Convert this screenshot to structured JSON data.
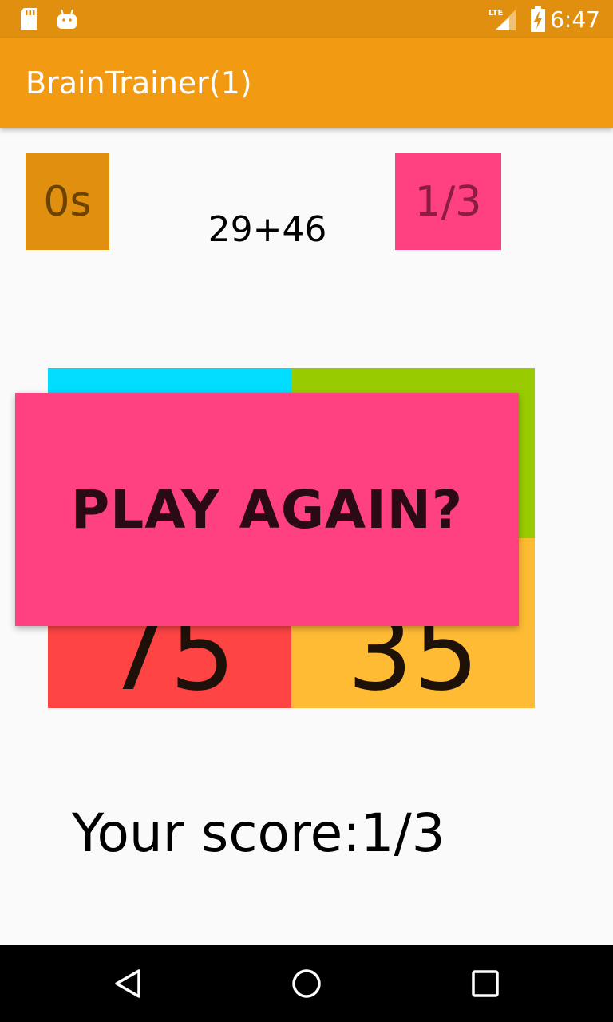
{
  "status_bar": {
    "time": "6:47",
    "network": "LTE",
    "icons": [
      "sd-card-icon",
      "android-icon",
      "signal-icon",
      "battery-charging-icon"
    ]
  },
  "app_bar": {
    "title": "BrainTrainer(1)"
  },
  "game": {
    "timer": "0s",
    "question": "29+46",
    "score": "1/3",
    "answers": [
      "",
      "",
      "75",
      "35"
    ],
    "play_again_label": "PLAY AGAIN?",
    "result": "Your score:1/3"
  },
  "colors": {
    "status_bar": "#e0900e",
    "app_bar": "#f29a12",
    "timer_bg": "#e0900e",
    "score_bg": "#ff4081",
    "answer_1": "#00ddff",
    "answer_2": "#99cc00",
    "answer_3": "#ff4444",
    "answer_4": "#ffbb33",
    "play_again_bg": "#ff4081"
  },
  "nav_bar": {
    "icons": [
      "back-icon",
      "home-icon",
      "recents-icon"
    ]
  }
}
